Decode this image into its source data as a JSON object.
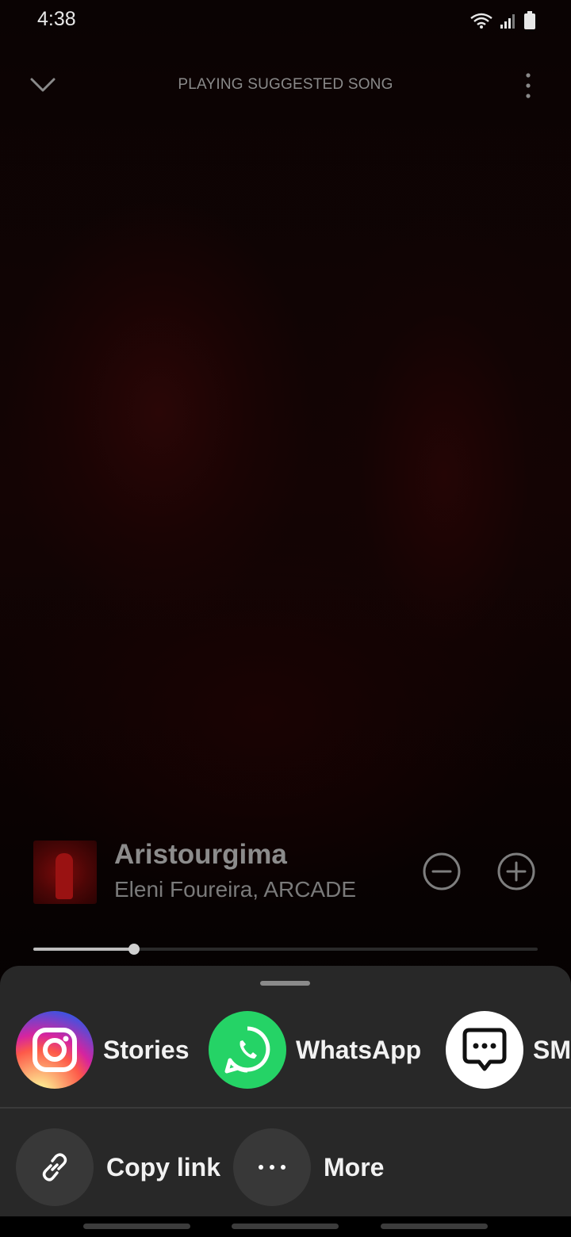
{
  "status_bar": {
    "time": "4:38"
  },
  "header": {
    "context": "PLAYING SUGGESTED SONG"
  },
  "track": {
    "title": "Aristourgima",
    "artist": "Eleni Foureira, ARCADE"
  },
  "playback": {
    "progress_fraction": 0.2
  },
  "share_sheet": {
    "targets": [
      {
        "label": "Stories",
        "icon": "instagram-icon"
      },
      {
        "label": "WhatsApp",
        "icon": "whatsapp-icon"
      },
      {
        "label": "SMS",
        "icon": "sms-icon"
      }
    ],
    "actions": [
      {
        "label": "Copy link",
        "icon": "link-icon"
      },
      {
        "label": "More",
        "icon": "more-dots-icon"
      }
    ]
  },
  "colors": {
    "instagram_gradient": [
      "#feda75",
      "#fa7e1e",
      "#d62976",
      "#962fbf",
      "#4f5bd5"
    ],
    "whatsapp": "#25d366",
    "sheet_bg": "#282828"
  }
}
